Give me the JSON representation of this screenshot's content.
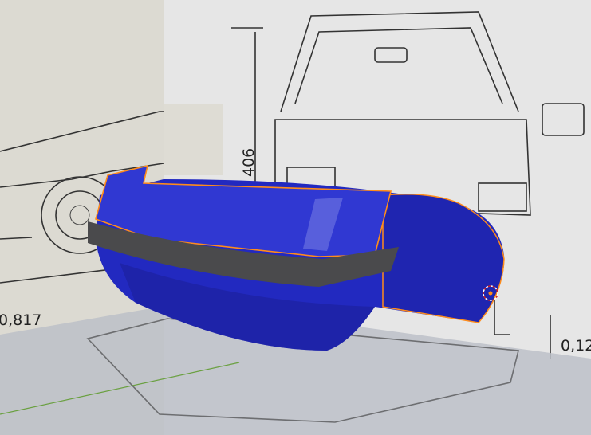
{
  "viewport": {
    "type": "3d-viewport",
    "selected_object": "bumper-mesh",
    "colors": {
      "mesh": "#2a2fc8",
      "mesh_dark": "#1c1f9a",
      "rubber_strip": "#4a4a4c",
      "selection_outline": "#ff8c1a",
      "side_reference_bg": "#dcdad2",
      "front_reference_bg": "#e6e6e6",
      "floor_plane": "#bcc0c8",
      "grid_axis_y": "#6aa040"
    }
  },
  "blueprint": {
    "height_dim": "406",
    "side_dim": "0,817",
    "front_dim": "0,12"
  }
}
